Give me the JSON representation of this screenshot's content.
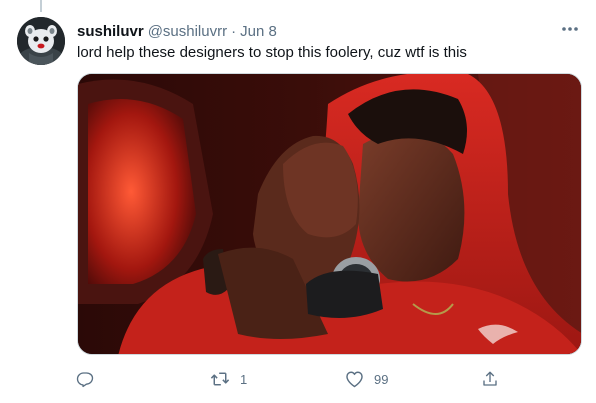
{
  "tweet": {
    "display_name": "sushiluvr",
    "handle": "@sushiluvrr",
    "separator": "·",
    "date": "Jun 8",
    "text": "lord help these designers to stop this foolery, cuz wtf is this"
  },
  "actions": {
    "reply_count": "",
    "retweet_count": "1",
    "like_count": "99"
  },
  "icons": {
    "more": "more-options-icon",
    "reply": "reply-icon",
    "retweet": "retweet-icon",
    "like": "heart-icon",
    "share": "share-icon"
  },
  "colors": {
    "text": "#0f1419",
    "secondary": "#5b7083",
    "border": "#cfd9de",
    "hoodie_red": "#c8201c"
  }
}
